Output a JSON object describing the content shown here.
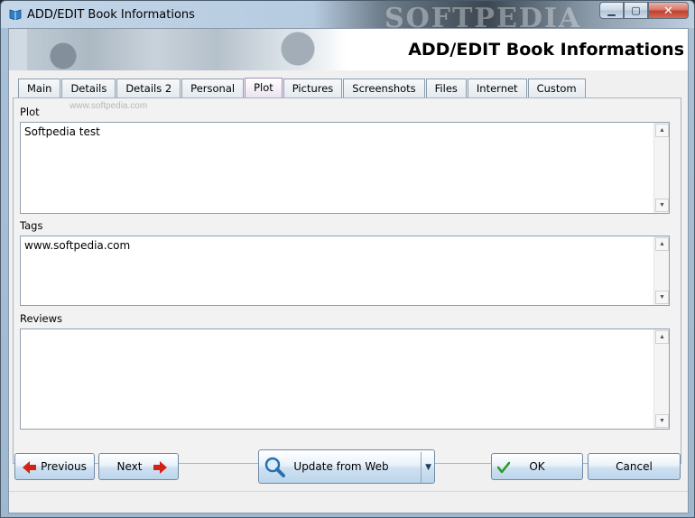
{
  "window": {
    "title": "ADD/EDIT Book Informations",
    "watermark": "SOFTPEDIA",
    "controls": {
      "minimize_icon": "minimize-icon",
      "maximize_icon": "maximize-icon",
      "close_icon": "close-icon"
    }
  },
  "header": {
    "title": "ADD/EDIT Book Informations"
  },
  "tabs": [
    {
      "label": "Main"
    },
    {
      "label": "Details"
    },
    {
      "label": "Details 2"
    },
    {
      "label": "Personal"
    },
    {
      "label": "Plot",
      "active": true
    },
    {
      "label": "Pictures"
    },
    {
      "label": "Screenshots"
    },
    {
      "label": "Files"
    },
    {
      "label": "Internet"
    },
    {
      "label": "Custom"
    }
  ],
  "panel": {
    "watermark": "www.softpedia.com",
    "plot": {
      "label": "Plot",
      "value": "Softpedia test"
    },
    "tags": {
      "label": "Tags",
      "value": "www.softpedia.com"
    },
    "reviews": {
      "label": "Reviews",
      "value": ""
    }
  },
  "buttons": {
    "previous": "Previous",
    "next": "Next",
    "update_from_web": "Update from Web",
    "ok": "OK",
    "cancel": "Cancel"
  },
  "colors": {
    "arrow": "#d22416",
    "check": "#2e9a2a",
    "active_tab": "#ece3f1"
  }
}
